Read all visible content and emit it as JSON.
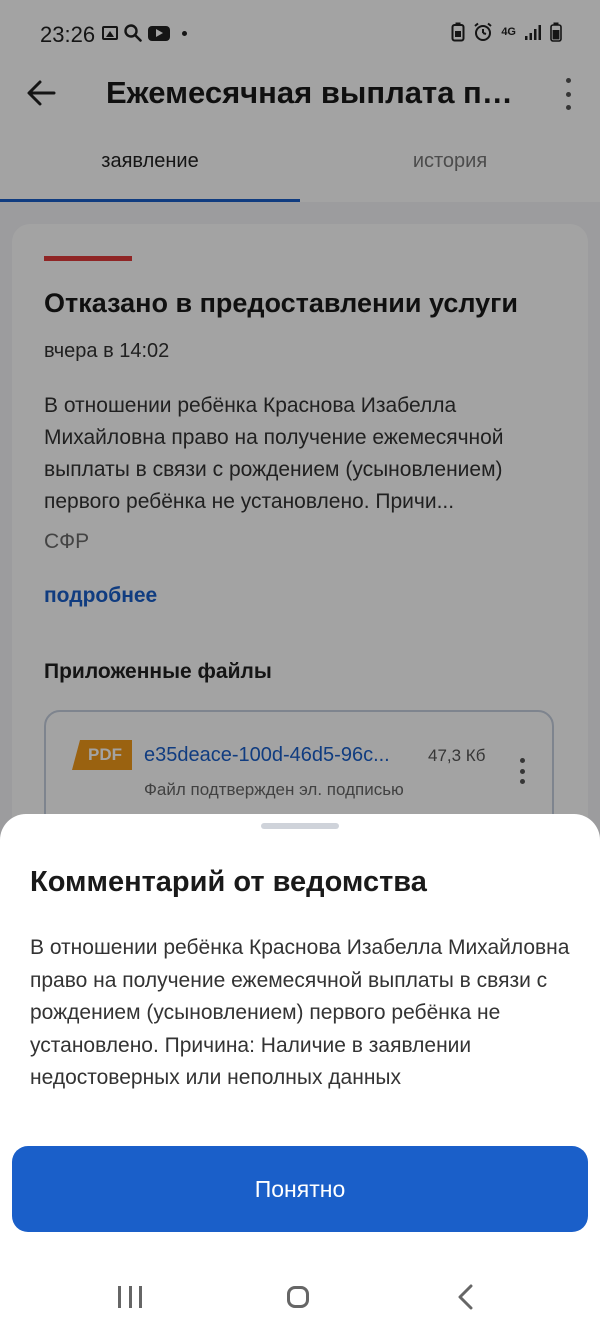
{
  "status_bar": {
    "time": "23:26",
    "network": "4G"
  },
  "app_bar": {
    "title": "Ежемесячная выплата при рождении первого ребёнка"
  },
  "tabs": [
    {
      "label": "заявление",
      "active": true
    },
    {
      "label": "история",
      "active": false
    }
  ],
  "card": {
    "status_color": "#e03a3a",
    "title": "Отказано в предоставлении услуги",
    "time": "вчера в 14:02",
    "description": "В отношении ребёнка Краснова Изабелла Михайловна право на получение ежемесячной выплаты в связи с рождением (усыновлением) первого ребёнка не установлено. Причи...",
    "organization": "СФР",
    "more_link": "подробнее",
    "files_title": "Приложенные файлы",
    "file": {
      "type_badge": "PDF",
      "name": "e35deace-100d-46d5-96c...",
      "size": "47,3 Кб",
      "signature": "Файл подтвержден эл. подписью"
    }
  },
  "sheet": {
    "title": "Комментарий от ведомства",
    "text": "В отношении ребёнка Краснова Изабелла Михайловна право на получение ежемесячной выплаты в связи с рождением (усыновлением) первого ребёнка не установлено. Причина: Наличие в заявлении недостоверных или неполных данных",
    "button_label": "Понятно"
  },
  "colors": {
    "accent": "#1a5fc9",
    "pdf_badge": "#f19a1a"
  }
}
